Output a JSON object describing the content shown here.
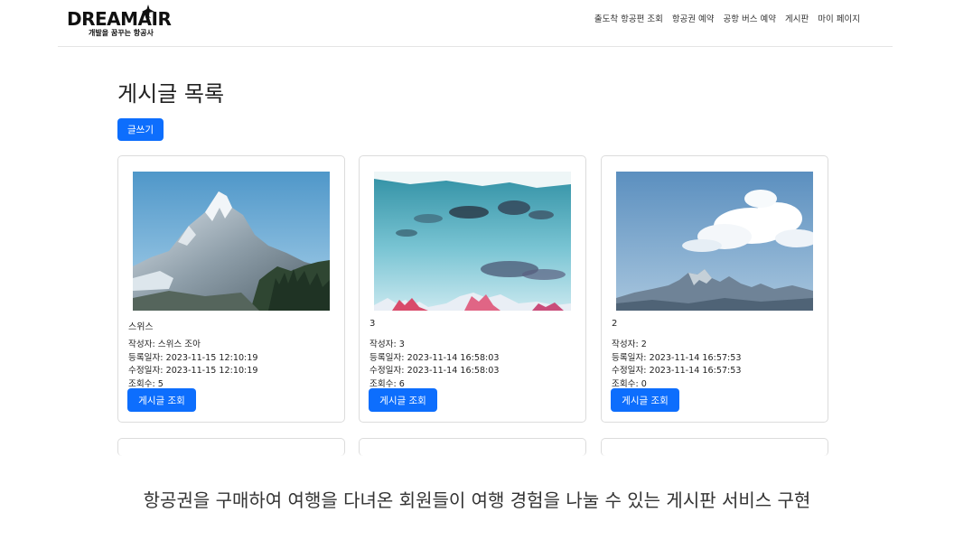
{
  "brand": {
    "name": "DREAMAIR",
    "tagline": "개발을 꿈꾸는 항공사"
  },
  "nav": {
    "items": [
      "출도착 항공편 조회",
      "항공권 예약",
      "공항 버스 예약",
      "게시판",
      "마이 페이지"
    ]
  },
  "page": {
    "title": "게시글 목록",
    "write_button": "글쓰기"
  },
  "labels": {
    "writer": "작성자: ",
    "created": "등록일자: ",
    "updated": "수정일자: ",
    "views": "조회수: ",
    "view_button": "게시글 조회"
  },
  "posts": [
    {
      "image": "mountain-peak-forest",
      "title": "스위스",
      "writer": "스위스 조아",
      "created": "2023-11-15 12:10:19",
      "updated": "2023-11-15 12:10:19",
      "views": "5"
    },
    {
      "image": "teal-sky-clouds",
      "title": "3",
      "writer": "3",
      "created": "2023-11-14 16:58:03",
      "updated": "2023-11-14 16:58:03",
      "views": "6"
    },
    {
      "image": "alpine-ridge-clouds",
      "title": "2",
      "writer": "2",
      "created": "2023-11-14 16:57:53",
      "updated": "2023-11-14 16:57:53",
      "views": "0"
    }
  ],
  "caption": "항공권을 구매하여 여행을 다녀온 회원들이 여행 경험을 나눌 수 있는 게시판 서비스 구현",
  "colors": {
    "primary": "#0d6efd",
    "border": "#dcdcdc"
  }
}
